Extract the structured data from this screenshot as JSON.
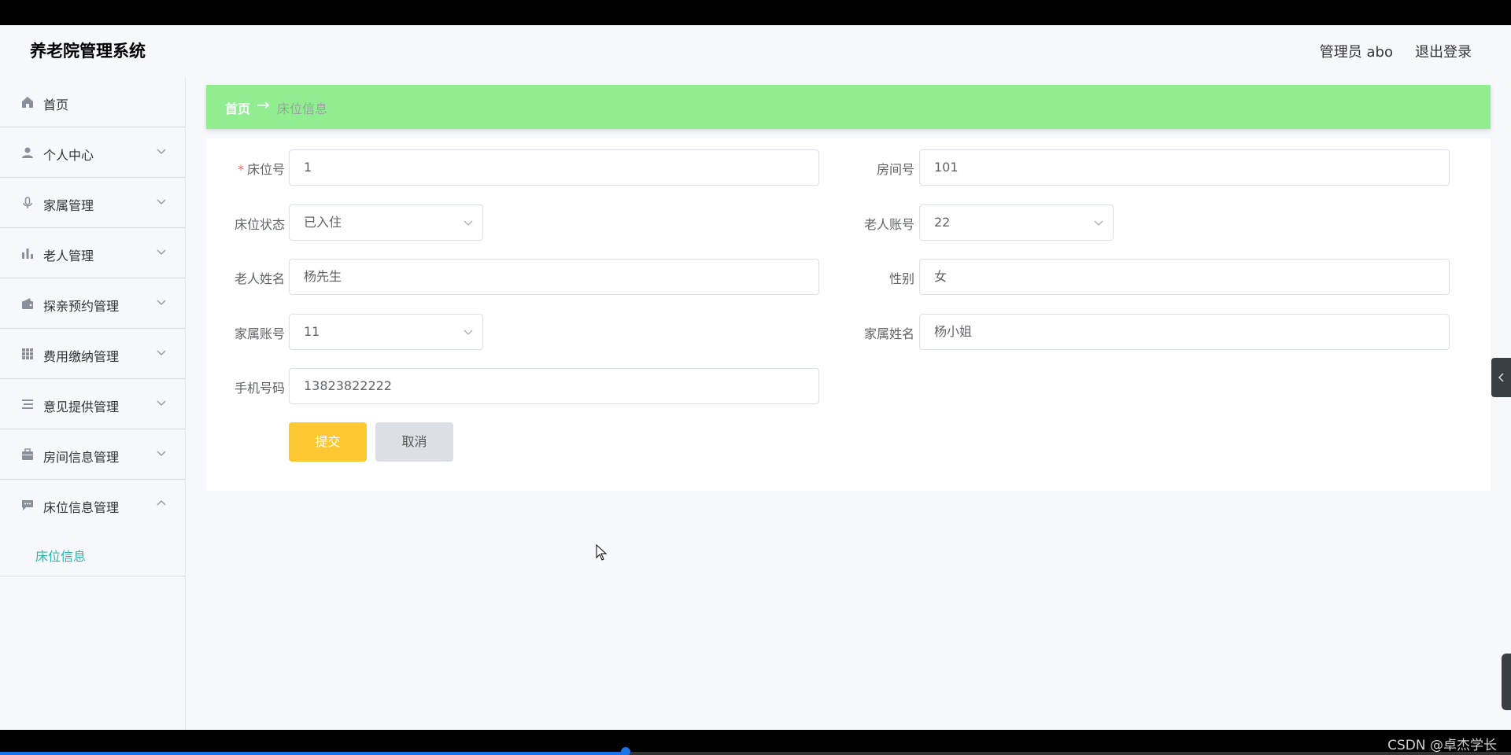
{
  "header": {
    "app_title": "养老院管理系统",
    "user_info": "管理员 abo",
    "logout": "退出登录"
  },
  "sidebar": {
    "items": [
      {
        "label": "首页",
        "icon": "home-icon"
      },
      {
        "label": "个人中心",
        "icon": "user-icon"
      },
      {
        "label": "家属管理",
        "icon": "microphone-icon"
      },
      {
        "label": "老人管理",
        "icon": "bar-chart-icon"
      },
      {
        "label": "探亲预约管理",
        "icon": "wallet-icon"
      },
      {
        "label": "费用缴纳管理",
        "icon": "grid-icon"
      },
      {
        "label": "意见提供管理",
        "icon": "list-icon"
      },
      {
        "label": "房间信息管理",
        "icon": "briefcase-icon"
      },
      {
        "label": "床位信息管理",
        "icon": "message-icon"
      }
    ],
    "sub_item": "床位信息"
  },
  "breadcrumb": {
    "home": "首页",
    "separator": "→",
    "current": "床位信息"
  },
  "form": {
    "bed_no_label": "床位号",
    "bed_no_value": "1",
    "room_no_label": "房间号",
    "room_no_value": "101",
    "bed_status_label": "床位状态",
    "bed_status_value": "已入住",
    "elder_account_label": "老人账号",
    "elder_account_value": "22",
    "elder_name_label": "老人姓名",
    "elder_name_value": "杨先生",
    "gender_label": "性别",
    "gender_value": "女",
    "family_account_label": "家属账号",
    "family_account_value": "11",
    "family_name_label": "家属姓名",
    "family_name_value": "杨小姐",
    "phone_label": "手机号码",
    "phone_value": "13823822222",
    "required_mark": "*",
    "submit": "提交",
    "cancel": "取消"
  },
  "watermark": "CSDN @卓杰学长",
  "colors": {
    "breadcrumb_bg": "#90ee90",
    "submit_bg": "#fdc832",
    "active_submenu": "#2fb5a6"
  }
}
